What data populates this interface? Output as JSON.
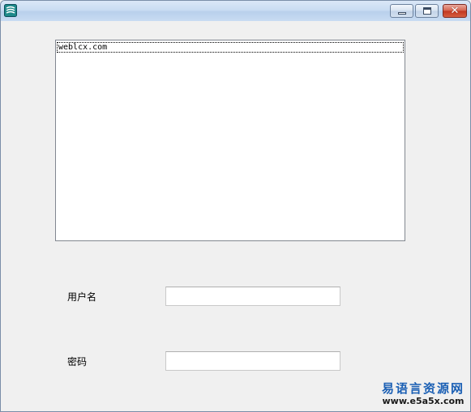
{
  "window": {
    "controls": {
      "minimize_icon": "minimize-icon",
      "maximize_icon": "maximize-icon",
      "close_glyph": "✕"
    }
  },
  "listbox": {
    "items": [
      "weblcx.com"
    ]
  },
  "form": {
    "username_label": "用户名",
    "username_value": "",
    "password_label": "密码",
    "password_value": ""
  },
  "watermark": {
    "line1": "易语言资源网",
    "line2": "www.e5a5x.com"
  },
  "colors": {
    "watermark_blue": "#1a5fb4",
    "close_red": "#c2361f"
  }
}
